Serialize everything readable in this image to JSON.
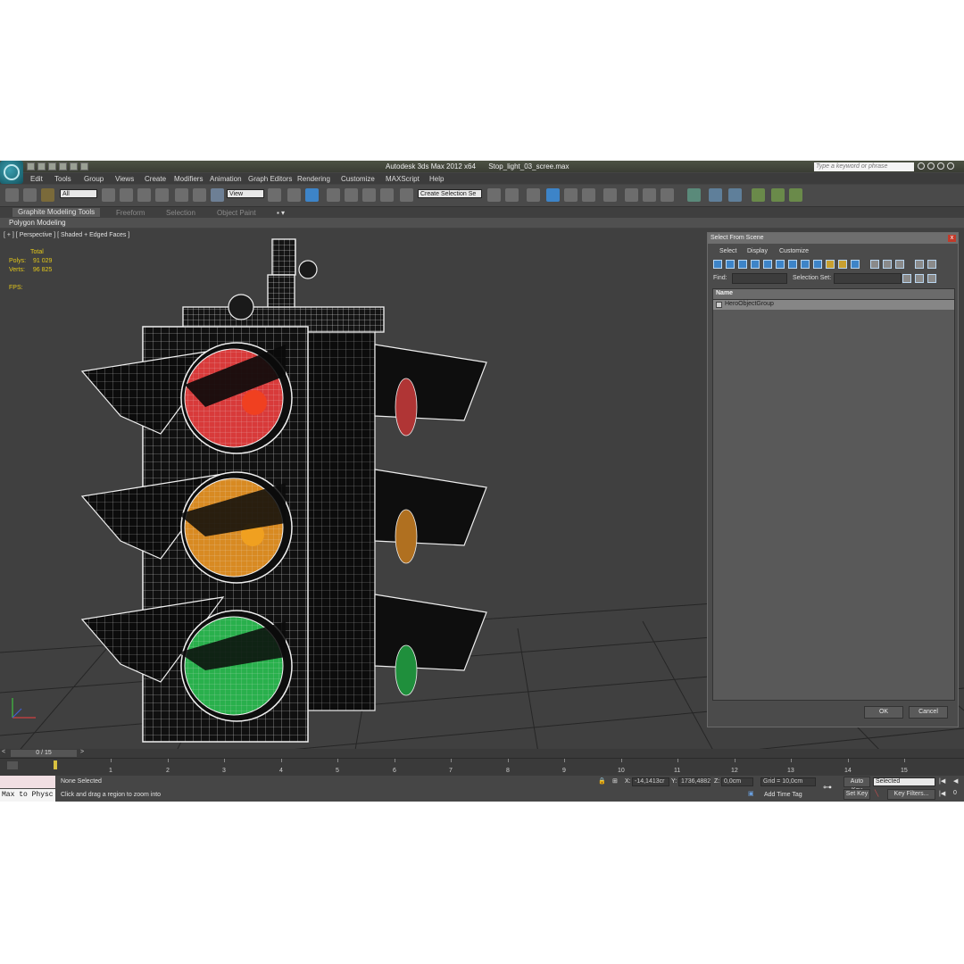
{
  "window": {
    "app_title": "Autodesk 3ds Max  2012 x64",
    "file_name": "Stop_light_03_scree.max",
    "search_placeholder": "Type a keyword or phrase"
  },
  "menu": [
    "Edit",
    "Tools",
    "Group",
    "Views",
    "Create",
    "Modifiers",
    "Animation",
    "Graph Editors",
    "Rendering",
    "Customize",
    "MAXScript",
    "Help"
  ],
  "toolbar": {
    "filter_value": "All",
    "refcoord_value": "View",
    "selection_set_placeholder": "Create Selection Se"
  },
  "ribbon": {
    "tabs": [
      "Graphite Modeling Tools",
      "Freeform",
      "Selection",
      "Object Paint"
    ],
    "panel": "Polygon Modeling"
  },
  "viewport": {
    "label": "[ + ] [ Perspective ] [ Shaded + Edged Faces ]",
    "stats_title": "Total",
    "polys_label": "Polys:",
    "polys_value": "91 029",
    "verts_label": "Verts:",
    "verts_value": "96 825",
    "fps_label": "FPS:"
  },
  "dialog": {
    "title": "Select From Scene",
    "close": "x",
    "menus": [
      "Select",
      "Display",
      "Customize"
    ],
    "find_label": "Find:",
    "selection_set_label": "Selection Set:",
    "column_name": "Name",
    "items": [
      "HeroObjectGroup"
    ],
    "ok": "OK",
    "cancel": "Cancel"
  },
  "timeline": {
    "frame_indicator": "0 / 15",
    "ticks": [
      "1",
      "2",
      "3",
      "4",
      "5",
      "6",
      "7",
      "8",
      "9",
      "10",
      "11",
      "12",
      "13",
      "14",
      "15"
    ]
  },
  "status": {
    "macro_recorder": "Max to Physc",
    "selection": "None Selected",
    "prompt": "Click and drag a region to zoom into",
    "x_label": "X:",
    "x_value": "-14,1413cr",
    "y_label": "Y:",
    "y_value": "1736,4882",
    "z_label": "Z:",
    "z_value": "0,0cm",
    "grid": "Grid = 10,0cm",
    "add_time_tag": "Add Time Tag",
    "auto_key": "Auto Key",
    "set_key": "Set Key",
    "key_mode_value": "Selected",
    "key_filters": "Key Filters..."
  },
  "colors": {
    "red_lens": "#d83a3a",
    "amber_lens": "#d88a22",
    "green_lens": "#29b04c",
    "wire": "#f2f2f2",
    "stats_text": "#e3c71a"
  }
}
